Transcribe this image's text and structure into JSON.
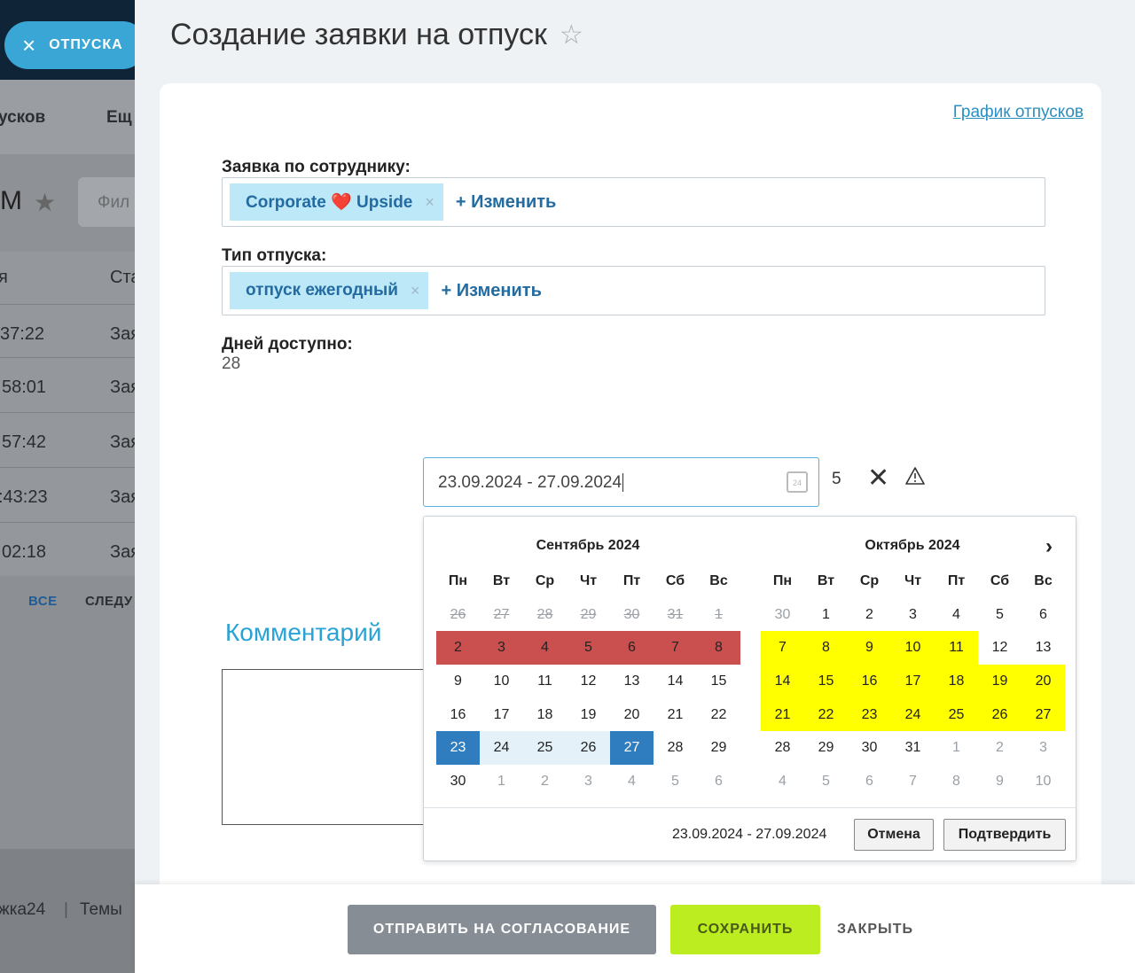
{
  "background": {
    "pill_label": "ОТПУСКА",
    "nav_1": "усков",
    "nav_2": "Ещ",
    "title_fragment": "М",
    "filter_placeholder": "Фил",
    "col_1": "я",
    "col_2": "Ста",
    "rows": [
      {
        "time": "37:22",
        "status": "Зая"
      },
      {
        "time": "58:01",
        "status": "Зая"
      },
      {
        "time": "57:42",
        "status": "Зая"
      },
      {
        "time": ":43:23",
        "status": "Зая"
      },
      {
        "time": "02:18",
        "status": "Зая"
      }
    ],
    "link_all": "ВСЕ",
    "link_next": "СЛЕДУ",
    "footer_1": "жка24",
    "footer_2": "Темы"
  },
  "page": {
    "title": "Создание заявки на отпуск",
    "schedule_link": "График отпусков"
  },
  "form": {
    "employee_label": "Заявка по сотруднику:",
    "employee_tag_1": "Corporate",
    "employee_tag_2": "Upside",
    "change_label": "+ Изменить",
    "type_label": "Тип отпуска:",
    "type_tag": "отпуск ежегодный",
    "days_label": "Дней доступно:",
    "days_value": "28",
    "comment_label": "Комментарий"
  },
  "date_picker": {
    "input_value": "23.09.2024 - 27.09.2024",
    "icon_day": "24",
    "days_count": "5",
    "weekdays": [
      "Пн",
      "Вт",
      "Ср",
      "Чт",
      "Пт",
      "Сб",
      "Вс"
    ],
    "months": [
      {
        "title": "Сентябрь 2024",
        "days": [
          {
            "d": "26",
            "s": "off"
          },
          {
            "d": "27",
            "s": "off"
          },
          {
            "d": "28",
            "s": "off"
          },
          {
            "d": "29",
            "s": "off"
          },
          {
            "d": "30",
            "s": "off"
          },
          {
            "d": "31",
            "s": "off"
          },
          {
            "d": "1",
            "s": "off"
          },
          {
            "d": "2",
            "s": "red"
          },
          {
            "d": "3",
            "s": "red"
          },
          {
            "d": "4",
            "s": "red"
          },
          {
            "d": "5",
            "s": "red"
          },
          {
            "d": "6",
            "s": "red"
          },
          {
            "d": "7",
            "s": "red"
          },
          {
            "d": "8",
            "s": "red"
          },
          {
            "d": "9",
            "s": ""
          },
          {
            "d": "10",
            "s": ""
          },
          {
            "d": "11",
            "s": ""
          },
          {
            "d": "12",
            "s": ""
          },
          {
            "d": "13",
            "s": ""
          },
          {
            "d": "14",
            "s": ""
          },
          {
            "d": "15",
            "s": ""
          },
          {
            "d": "16",
            "s": ""
          },
          {
            "d": "17",
            "s": ""
          },
          {
            "d": "18",
            "s": ""
          },
          {
            "d": "19",
            "s": ""
          },
          {
            "d": "20",
            "s": ""
          },
          {
            "d": "21",
            "s": ""
          },
          {
            "d": "22",
            "s": ""
          },
          {
            "d": "23",
            "s": "sel"
          },
          {
            "d": "24",
            "s": "range"
          },
          {
            "d": "25",
            "s": "range"
          },
          {
            "d": "26",
            "s": "range"
          },
          {
            "d": "27",
            "s": "sel"
          },
          {
            "d": "28",
            "s": ""
          },
          {
            "d": "29",
            "s": ""
          },
          {
            "d": "30",
            "s": ""
          },
          {
            "d": "1",
            "s": "gray"
          },
          {
            "d": "2",
            "s": "gray"
          },
          {
            "d": "3",
            "s": "gray"
          },
          {
            "d": "4",
            "s": "gray"
          },
          {
            "d": "5",
            "s": "gray"
          },
          {
            "d": "6",
            "s": "gray"
          }
        ]
      },
      {
        "title": "Октябрь 2024",
        "days": [
          {
            "d": "30",
            "s": "gray"
          },
          {
            "d": "1",
            "s": ""
          },
          {
            "d": "2",
            "s": ""
          },
          {
            "d": "3",
            "s": ""
          },
          {
            "d": "4",
            "s": ""
          },
          {
            "d": "5",
            "s": ""
          },
          {
            "d": "6",
            "s": ""
          },
          {
            "d": "7",
            "s": "yel"
          },
          {
            "d": "8",
            "s": "yel"
          },
          {
            "d": "9",
            "s": "yel"
          },
          {
            "d": "10",
            "s": "yel"
          },
          {
            "d": "11",
            "s": "yel"
          },
          {
            "d": "12",
            "s": ""
          },
          {
            "d": "13",
            "s": ""
          },
          {
            "d": "14",
            "s": "yel"
          },
          {
            "d": "15",
            "s": "yel"
          },
          {
            "d": "16",
            "s": "yel"
          },
          {
            "d": "17",
            "s": "yel"
          },
          {
            "d": "18",
            "s": "yel"
          },
          {
            "d": "19",
            "s": "yel"
          },
          {
            "d": "20",
            "s": "yel"
          },
          {
            "d": "21",
            "s": "yel"
          },
          {
            "d": "22",
            "s": "yel"
          },
          {
            "d": "23",
            "s": "yel"
          },
          {
            "d": "24",
            "s": "yel"
          },
          {
            "d": "25",
            "s": "yel"
          },
          {
            "d": "26",
            "s": "yel"
          },
          {
            "d": "27",
            "s": "yel"
          },
          {
            "d": "28",
            "s": ""
          },
          {
            "d": "29",
            "s": ""
          },
          {
            "d": "30",
            "s": ""
          },
          {
            "d": "31",
            "s": ""
          },
          {
            "d": "1",
            "s": "gray"
          },
          {
            "d": "2",
            "s": "gray"
          },
          {
            "d": "3",
            "s": "gray"
          },
          {
            "d": "4",
            "s": "gray"
          },
          {
            "d": "5",
            "s": "gray"
          },
          {
            "d": "6",
            "s": "gray"
          },
          {
            "d": "7",
            "s": "gray"
          },
          {
            "d": "8",
            "s": "gray"
          },
          {
            "d": "9",
            "s": "gray"
          },
          {
            "d": "10",
            "s": "gray"
          }
        ]
      }
    ],
    "selected_range": "23.09.2024 - 27.09.2024",
    "cancel_label": "Отмена",
    "confirm_label": "Подтвердить"
  },
  "footer": {
    "send_label": "ОТПРАВИТЬ НА СОГЛАСОВАНИЕ",
    "save_label": "СОХРАНИТЬ",
    "close_label": "ЗАКРЫТЬ"
  },
  "colors": {
    "accent": "#2aa3d4",
    "save_button": "#bbed21",
    "send_button": "#868d95",
    "holiday": "#c9504f",
    "vacation_highlight": "#ffff00",
    "selected": "#2f7dbf"
  }
}
